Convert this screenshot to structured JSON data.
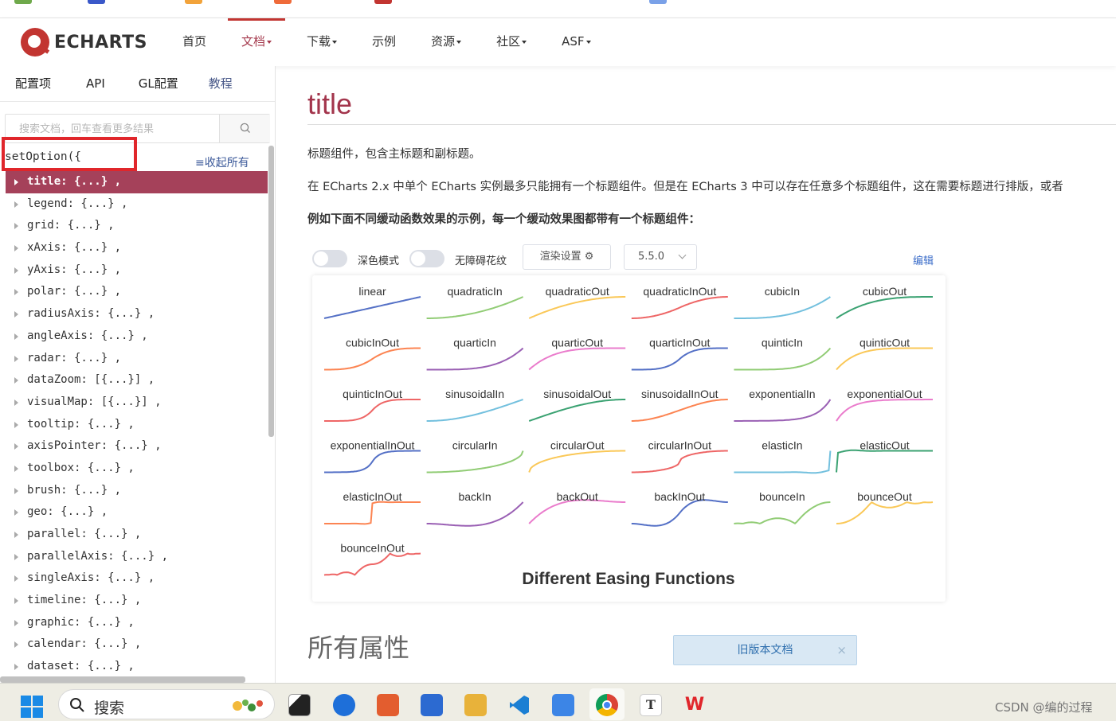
{
  "browser": {
    "strip_colors": [
      "#6fa94b",
      "#3a58c9",
      "#f2a33a",
      "#ef6b3a",
      "#c23531",
      "#7aa1e8"
    ]
  },
  "header": {
    "logo_text": "ECHARTS",
    "nav": [
      {
        "label": "首页",
        "active": false,
        "dropdown": false
      },
      {
        "label": "文档",
        "active": true,
        "dropdown": true
      },
      {
        "label": "下载",
        "active": false,
        "dropdown": true
      },
      {
        "label": "示例",
        "active": false,
        "dropdown": false
      },
      {
        "label": "资源",
        "active": false,
        "dropdown": true
      },
      {
        "label": "社区",
        "active": false,
        "dropdown": true
      },
      {
        "label": "ASF",
        "active": false,
        "dropdown": true
      }
    ]
  },
  "sidebar": {
    "tabs": [
      "配置项",
      "API",
      "GL配置",
      "教程"
    ],
    "search_placeholder": "搜索文档，回车查看更多结果",
    "setoption_label": "setOption({",
    "collapse_all_label": "≡收起所有",
    "tree": [
      "title: {...} ,",
      "legend: {...} ,",
      "grid: {...} ,",
      "xAxis: {...} ,",
      "yAxis: {...} ,",
      "polar: {...} ,",
      "radiusAxis: {...} ,",
      "angleAxis: {...} ,",
      "radar: {...} ,",
      "dataZoom: [{...}] ,",
      "visualMap: [{...}] ,",
      "tooltip: {...} ,",
      "axisPointer: {...} ,",
      "toolbox: {...} ,",
      "brush: {...} ,",
      "geo: {...} ,",
      "parallel: {...} ,",
      "parallelAxis: {...} ,",
      "singleAxis: {...} ,",
      "timeline: {...} ,",
      "graphic: {...} ,",
      "calendar: {...} ,",
      "dataset: {...} ,"
    ],
    "active_index": 0
  },
  "main": {
    "title": "title",
    "p1": "标题组件，包含主标题和副标题。",
    "p2": "在 ECharts 2.x 中单个 ECharts 实例最多只能拥有一个标题组件。但是在 ECharts 3 中可以存在任意多个标题组件，这在需要标题进行排版，或者",
    "p3": "例如下面不同缓动函数效果的示例，每一个缓动效果图都带有一个标题组件：",
    "toolbar": {
      "dark_mode_label": "深色模式",
      "dark_mode_on": false,
      "a11y_label": "无障碍花纹",
      "a11y_on": false,
      "render_label": "渲染设置 ⚙",
      "version": "5.5.0",
      "edit_label": "编辑"
    },
    "all_props_heading": "所有属性",
    "old_docs_label": "旧版本文档",
    "old_docs_close": "×"
  },
  "chart_data": {
    "type": "line",
    "title": "Different Easing Functions",
    "colors": [
      "#5470c6",
      "#91cc75",
      "#fac858",
      "#ee6666",
      "#73c0de",
      "#3ba272",
      "#fc8452",
      "#9a60b4",
      "#ea7ccc"
    ],
    "series": [
      {
        "name": "linear"
      },
      {
        "name": "quadraticIn"
      },
      {
        "name": "quadraticOut"
      },
      {
        "name": "quadraticInOut"
      },
      {
        "name": "cubicIn"
      },
      {
        "name": "cubicOut"
      },
      {
        "name": "cubicInOut"
      },
      {
        "name": "quarticIn"
      },
      {
        "name": "quarticOut"
      },
      {
        "name": "quarticInOut"
      },
      {
        "name": "quinticIn"
      },
      {
        "name": "quinticOut"
      },
      {
        "name": "quinticInOut"
      },
      {
        "name": "sinusoidalIn"
      },
      {
        "name": "sinusoidalOut"
      },
      {
        "name": "sinusoidalInOut"
      },
      {
        "name": "exponentialIn"
      },
      {
        "name": "exponentialOut"
      },
      {
        "name": "exponentialInOut"
      },
      {
        "name": "circularIn"
      },
      {
        "name": "circularOut"
      },
      {
        "name": "circularInOut"
      },
      {
        "name": "elasticIn"
      },
      {
        "name": "elasticOut"
      },
      {
        "name": "elasticInOut"
      },
      {
        "name": "backIn"
      },
      {
        "name": "backOut"
      },
      {
        "name": "backInOut"
      },
      {
        "name": "bounceIn"
      },
      {
        "name": "bounceOut"
      },
      {
        "name": "bounceInOut"
      }
    ],
    "x_range": [
      0,
      1
    ]
  },
  "taskbar": {
    "search_label": "搜索",
    "apps": [
      "task-view",
      "app-arrow",
      "app-slides",
      "store",
      "file-explorer",
      "vscode",
      "app-bird",
      "chrome",
      "typora",
      "wps"
    ],
    "watermark": "CSDN @编的过程"
  }
}
